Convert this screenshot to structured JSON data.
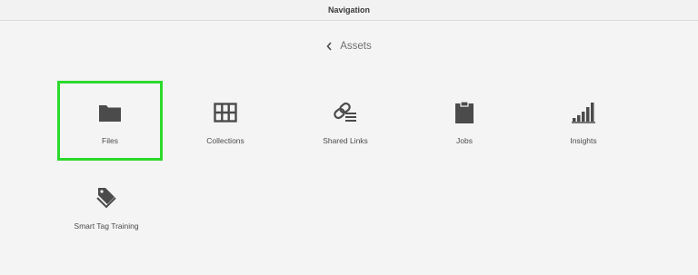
{
  "header": {
    "title": "Navigation"
  },
  "breadcrumb": {
    "label": "Assets",
    "back_icon": "chevron-left-icon"
  },
  "tiles": [
    {
      "label": "Files",
      "icon": "folder-icon",
      "selected": true
    },
    {
      "label": "Collections",
      "icon": "grid-icon",
      "selected": false
    },
    {
      "label": "Shared Links",
      "icon": "link-icon",
      "selected": false
    },
    {
      "label": "Jobs",
      "icon": "clipboard-icon",
      "selected": false
    },
    {
      "label": "Insights",
      "icon": "bar-chart-icon",
      "selected": false
    },
    {
      "label": "Smart Tag Training",
      "icon": "tags-icon",
      "selected": false
    }
  ],
  "colors": {
    "background": "#f4f4f4",
    "icon": "#4b4b4b",
    "selection_outline": "#2cd92c"
  }
}
